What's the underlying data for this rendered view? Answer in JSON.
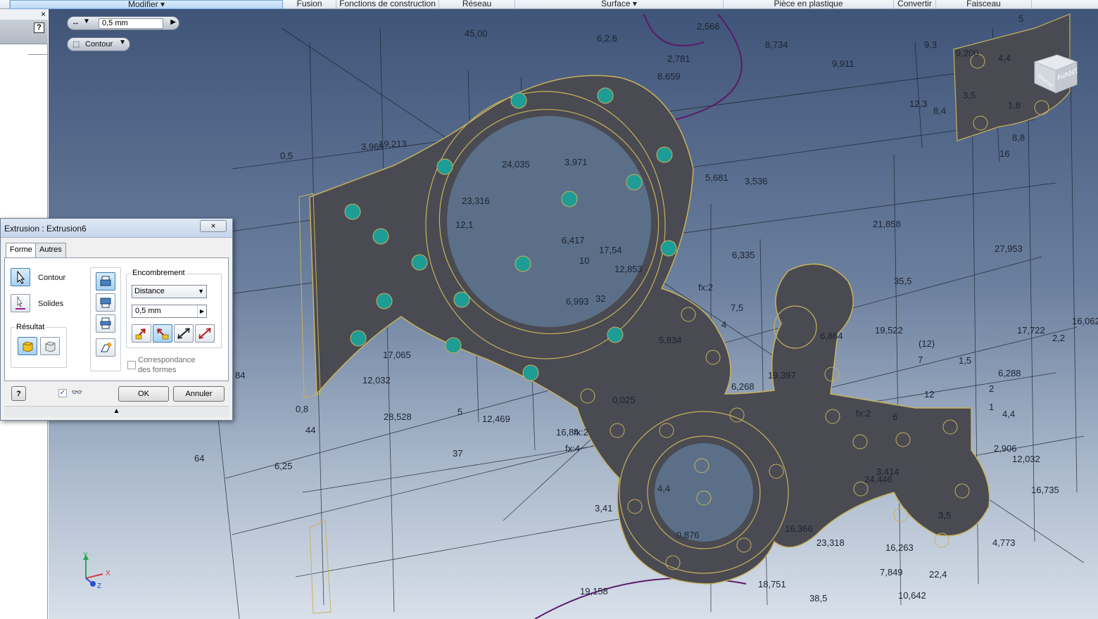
{
  "ribbon": {
    "tabs": [
      {
        "label": "Modifier ▾"
      },
      {
        "label": "Fusion"
      },
      {
        "label": "Fonctions de construction"
      },
      {
        "label": "Réseau"
      },
      {
        "label": "Surface ▾"
      },
      {
        "label": "Pièce en plastique"
      },
      {
        "label": "Convertir"
      },
      {
        "label": "Faisceau"
      }
    ]
  },
  "browser": {
    "close": "×",
    "help": "?"
  },
  "mini_toolbar": {
    "distance_value": "0,5 mm",
    "profile_label": "Contour"
  },
  "viewcube": {
    "front_label": "AVANT",
    "left_label": "GAUCHE"
  },
  "dialog": {
    "title": "Extrusion : Extrusion6",
    "close": "×",
    "tabs": [
      "Forme",
      "Autres"
    ],
    "profile_label": "Contour",
    "solids_label": "Solides",
    "result_label": "Résultat",
    "extents_label": "Encombrement",
    "extents_value": "Distance",
    "distance_value": "0,5 mm",
    "match_shape_label_1": "Correspondance",
    "match_shape_label_2": "des formes",
    "help": "?",
    "ok": "OK",
    "cancel": "Annuler",
    "expand": "▲"
  },
  "dimensions": {
    "d1": "45,00",
    "d2": "6,2,6",
    "d3": "2,566",
    "d4": "8,734",
    "d5": "9,911",
    "d6": "2,781",
    "d7": "8,659",
    "d8": "3,969",
    "d9": "19,213",
    "d10": "0,5",
    "d11": "24,035",
    "d12": "3,971",
    "d13": "5,681",
    "d14": "3,536",
    "d15": "23,316",
    "d16": "12,1",
    "d17": "6,417",
    "d18": "17,54",
    "d19": "10",
    "d20": "12,853",
    "d21": "6,993",
    "d22": "32",
    "d23": "fx:2",
    "d24": "7,5",
    "d25": "5,834",
    "d26": "4",
    "d27": "17,065",
    "d28": "12,032",
    "d29": "28,528",
    "d30": "12,469",
    "d31": "5",
    "d32": "16,84",
    "d33": "fx:2",
    "d34": "fx:4",
    "d35": "0,025",
    "d36": "37",
    "d37": "64",
    "d38": "6,25",
    "d39": "44",
    "d40": "0,8",
    "d41": "84",
    "d42": "3,41",
    "d43": "4,4",
    "d44": "0,876",
    "d45": "19,158",
    "d46": "21,858",
    "d47": "6,335",
    "d48": "27,953",
    "d49": "35,5",
    "d50": "19,522",
    "d51": "6,864",
    "d52": "(12)",
    "d53": "7",
    "d54": "1,5",
    "d55": "6,288",
    "d56": "17,722",
    "d57": "2,2",
    "d58": "16,062",
    "d59": "19,397",
    "d60": "6,268",
    "d61": "12",
    "d62": "2",
    "d63": "1",
    "d64": "4,4",
    "d65": "fx:2",
    "d66": "6",
    "d67": "2,906",
    "d68": "12,032",
    "d69": "3,414",
    "d70": "24,446",
    "d71": "16,735",
    "d72": "3,5",
    "d73": "16,366",
    "d74": "23,318",
    "d75": "16,263",
    "d76": "4,773",
    "d77": "7,849",
    "d78": "22,4",
    "d79": "18,751",
    "d80": "38,5",
    "d81": "10,642",
    "d82": "9,3",
    "d83": "9,200",
    "d84": "12,3",
    "d85": "8,4",
    "d86": "3,5",
    "d87": "1,8",
    "d88": "8,8",
    "d89": "16",
    "d90": "4,4",
    "d91": "5"
  },
  "axis": {
    "x": "X",
    "y": "Y",
    "z": "Z"
  },
  "colors": {
    "part_fill": "#4a4a52",
    "part_edge": "#c8b25a",
    "hole_fill": "#1e9c96",
    "sketch_line": "#1a1f2a",
    "arc_purple": "#5b1a6a"
  }
}
